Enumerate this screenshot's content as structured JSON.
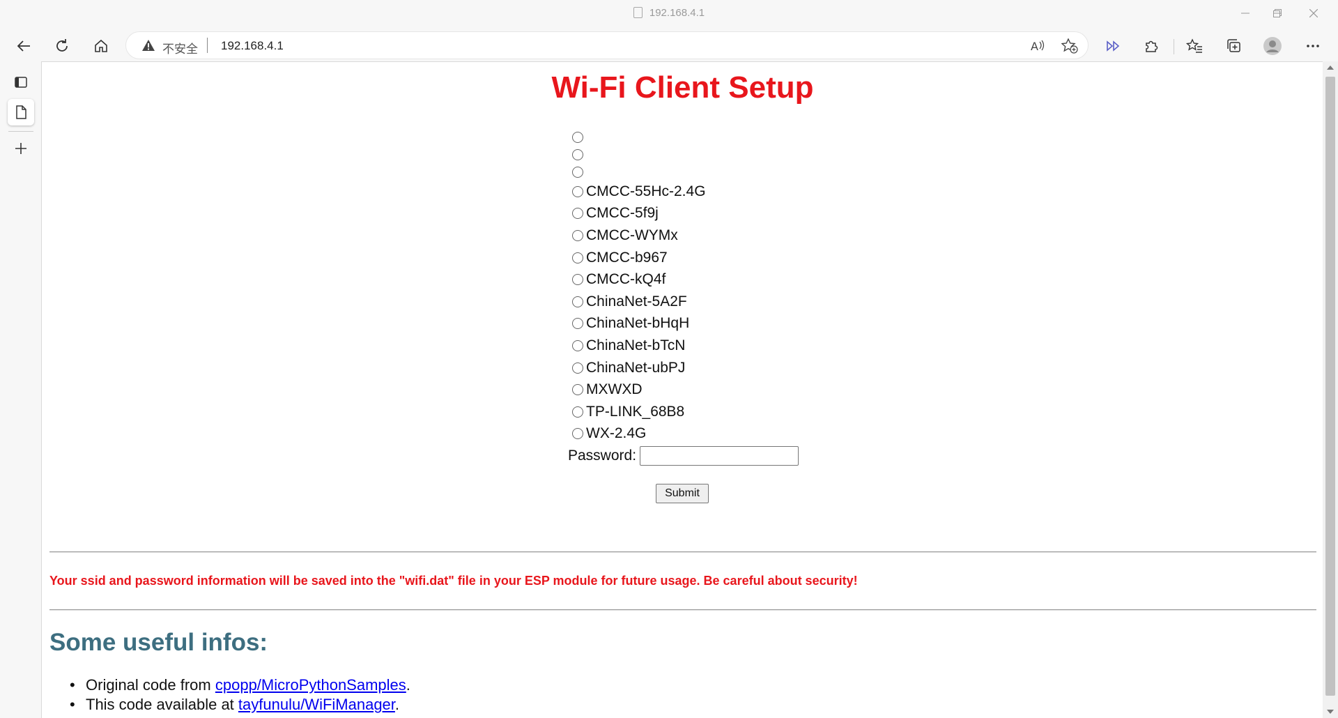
{
  "window": {
    "title": "192.168.4.1"
  },
  "address_bar": {
    "security_label": "不安全",
    "url": "192.168.4.1"
  },
  "page": {
    "title": "Wi-Fi Client Setup",
    "ssids": [
      "",
      "",
      "",
      "CMCC-55Hc-2.4G",
      "CMCC-5f9j",
      "CMCC-WYMx",
      "CMCC-b967",
      "CMCC-kQ4f",
      "ChinaNet-5A2F",
      "ChinaNet-bHqH",
      "ChinaNet-bTcN",
      "ChinaNet-ubPJ",
      "MXWXD",
      "TP-LINK_68B8",
      "WX-2.4G"
    ],
    "password_label": "Password:",
    "password_value": "",
    "submit_label": "Submit",
    "notice": "Your ssid and password information will be saved into the \"wifi.dat\" file in your ESP module for future usage. Be careful about security!",
    "infos_title": "Some useful infos:",
    "info1_prefix": "Original code from ",
    "info1_link": "cpopp/MicroPythonSamples",
    "info1_suffix": ".",
    "info2_prefix": "This code available at ",
    "info2_link": "tayfunulu/WiFiManager",
    "info2_suffix": "."
  },
  "colors": {
    "title": "#e8161c",
    "notice": "#e8161c",
    "infos_title": "#3d6e80",
    "link": "#0000ee"
  }
}
